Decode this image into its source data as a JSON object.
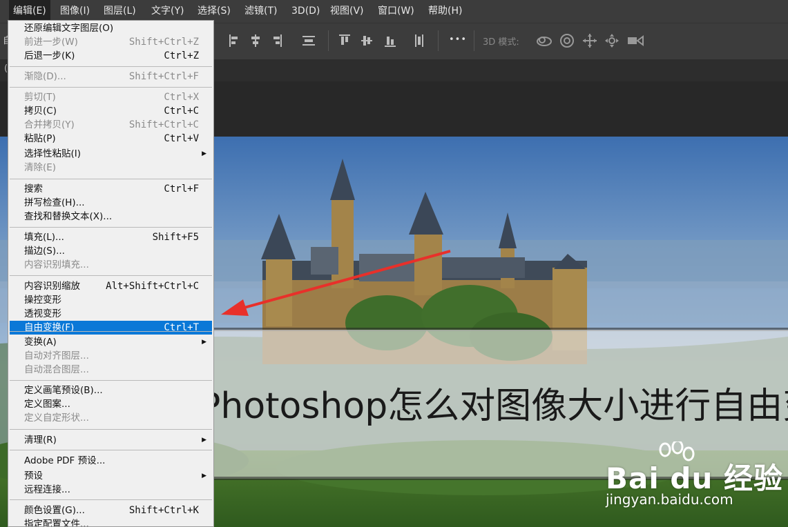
{
  "menubar": {
    "items": [
      {
        "label": "编辑(E)",
        "active": true
      },
      {
        "label": "图像(I)"
      },
      {
        "label": "图层(L)"
      },
      {
        "label": "文字(Y)"
      },
      {
        "label": "选择(S)"
      },
      {
        "label": "滤镜(T)"
      },
      {
        "label": "3D(D)"
      },
      {
        "label": "视图(V)"
      },
      {
        "label": "窗口(W)"
      },
      {
        "label": "帮助(H)"
      }
    ]
  },
  "optbar": {
    "left_fragment": "自",
    "mode_label": "3D 模式:",
    "more_label": "•••"
  },
  "tabbar": {
    "left_fragment": "("
  },
  "edit_menu": {
    "items": [
      {
        "label": "还原编辑文字图层(O)",
        "shortcut": ""
      },
      {
        "label": "前进一步(W)",
        "shortcut": "Shift+Ctrl+Z",
        "disabled": true
      },
      {
        "label": "后退一步(K)",
        "shortcut": "Ctrl+Z"
      },
      {
        "label": "渐隐(D)...",
        "shortcut": "Shift+Ctrl+F",
        "disabled": true
      },
      {
        "label": "剪切(T)",
        "shortcut": "Ctrl+X",
        "disabled": true
      },
      {
        "label": "拷贝(C)",
        "shortcut": "Ctrl+C"
      },
      {
        "label": "合并拷贝(Y)",
        "shortcut": "Shift+Ctrl+C",
        "disabled": true
      },
      {
        "label": "粘贴(P)",
        "shortcut": "Ctrl+V"
      },
      {
        "label": "选择性粘贴(I)",
        "shortcut": "",
        "submenu": true
      },
      {
        "label": "清除(E)",
        "shortcut": "",
        "disabled": true
      },
      {
        "label": "搜索",
        "shortcut": "Ctrl+F"
      },
      {
        "label": "拼写检查(H)...",
        "shortcut": ""
      },
      {
        "label": "查找和替换文本(X)...",
        "shortcut": ""
      },
      {
        "label": "填充(L)...",
        "shortcut": "Shift+F5"
      },
      {
        "label": "描边(S)...",
        "shortcut": ""
      },
      {
        "label": "内容识别填充...",
        "shortcut": "",
        "disabled": true
      },
      {
        "label": "内容识别缩放",
        "shortcut": "Alt+Shift+Ctrl+C"
      },
      {
        "label": "操控变形",
        "shortcut": ""
      },
      {
        "label": "透视变形",
        "shortcut": ""
      },
      {
        "label": "自由变换(F)",
        "shortcut": "Ctrl+T",
        "selected": true
      },
      {
        "label": "变换(A)",
        "shortcut": "",
        "submenu": true
      },
      {
        "label": "自动对齐图层...",
        "shortcut": "",
        "disabled": true
      },
      {
        "label": "自动混合图层...",
        "shortcut": "",
        "disabled": true
      },
      {
        "label": "定义画笔预设(B)...",
        "shortcut": ""
      },
      {
        "label": "定义图案...",
        "shortcut": ""
      },
      {
        "label": "定义自定形状...",
        "shortcut": "",
        "disabled": true
      },
      {
        "label": "清理(R)",
        "shortcut": "",
        "submenu": true
      },
      {
        "label": "Adobe PDF 预设...",
        "shortcut": ""
      },
      {
        "label": "预设",
        "shortcut": "",
        "submenu": true
      },
      {
        "label": "远程连接...",
        "shortcut": ""
      },
      {
        "label": "颜色设置(G)...",
        "shortcut": "Shift+Ctrl+K"
      },
      {
        "label": "指定配置文件...",
        "shortcut": ""
      }
    ]
  },
  "banner": {
    "text": "Photoshop怎么对图像大小进行自由变换"
  },
  "watermark": {
    "logo": "Bai du 经验",
    "url": "jingyan.baidu.com"
  },
  "colors": {
    "menu_highlight": "#0a78d7",
    "arrow": "#e8302a"
  }
}
